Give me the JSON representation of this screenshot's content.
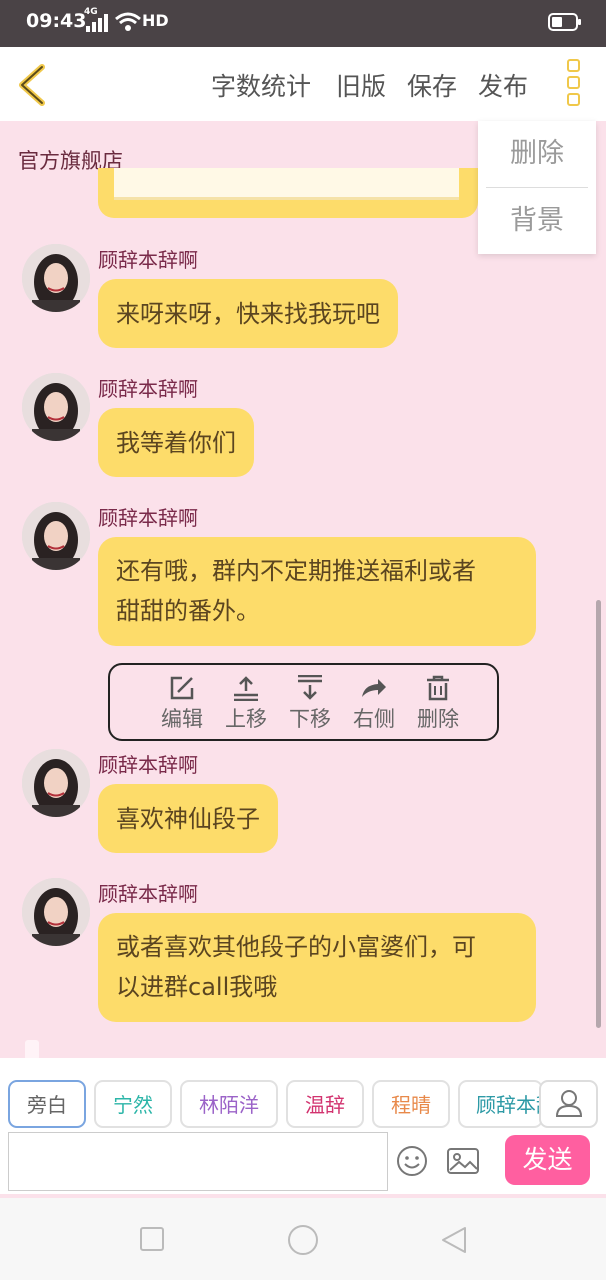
{
  "status_bar": {
    "time": "09:43",
    "network": "4G",
    "hd": "HD"
  },
  "header": {
    "actions": [
      "字数统计",
      "旧版",
      "保存",
      "发布"
    ]
  },
  "dropdown": {
    "items": [
      "删除",
      "背景"
    ]
  },
  "shop_label": "官方旗舰店",
  "messages": [
    {
      "sender": "顾辞本辞啊",
      "lines": [
        "来呀来呀，快来找我玩吧"
      ]
    },
    {
      "sender": "顾辞本辞啊",
      "lines": [
        "我等着你们"
      ]
    },
    {
      "sender": "顾辞本辞啊",
      "lines": [
        "还有哦，群内不定期推送福利或者",
        "甜甜的番外。"
      ]
    },
    {
      "sender": "顾辞本辞啊",
      "lines": [
        "喜欢神仙段子"
      ]
    },
    {
      "sender": "顾辞本辞啊",
      "lines": [
        "或者喜欢其他段子的小富婆们，可",
        "以进群call我哦"
      ]
    }
  ],
  "message_actions": [
    {
      "label": "编辑",
      "icon": "edit-icon"
    },
    {
      "label": "上移",
      "icon": "move-up-icon"
    },
    {
      "label": "下移",
      "icon": "move-down-icon"
    },
    {
      "label": "右侧",
      "icon": "share-right-icon"
    },
    {
      "label": "删除",
      "icon": "trash-icon"
    }
  ],
  "roles": [
    {
      "label": "旁白",
      "color": "#666666",
      "active": true
    },
    {
      "label": "宁然",
      "color": "#2bb5a8"
    },
    {
      "label": "林陌洋",
      "color": "#9b63c8"
    },
    {
      "label": "温辞",
      "color": "#d2336f"
    },
    {
      "label": "程晴",
      "color": "#e8894a"
    },
    {
      "label": "顾辞本辞啊",
      "color": "#2d9aa6"
    }
  ],
  "composer": {
    "input_value": "",
    "send_label": "发送"
  },
  "colors": {
    "bubble": "#fddc6a",
    "accent": "#f0c84a",
    "send": "#ff5fa0",
    "background": "#fbe1ea"
  }
}
